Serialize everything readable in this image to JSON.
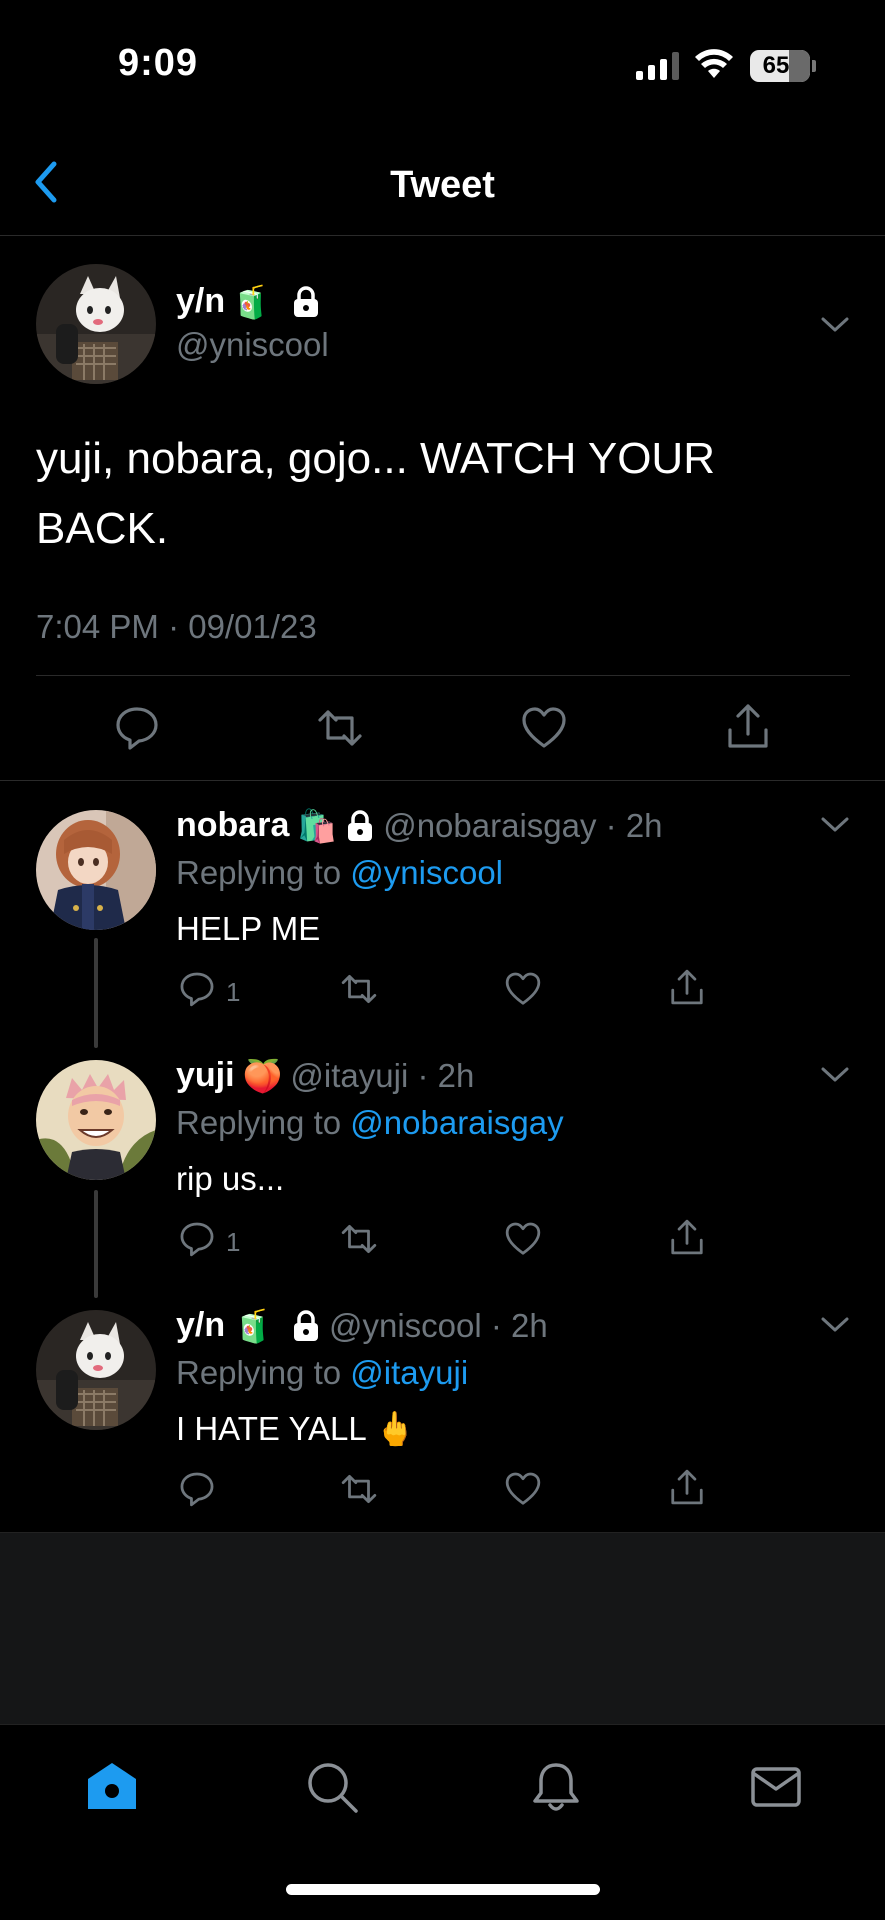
{
  "status_bar": {
    "time": "9:09",
    "battery": "65"
  },
  "header": {
    "title": "Tweet"
  },
  "main_tweet": {
    "name": "y/n",
    "name_emoji": "🧃",
    "handle": "@yniscool",
    "text": "yuji, nobara, gojo... WATCH YOUR BACK.",
    "timestamp": "7:04 PM · 09/01/23"
  },
  "replies": [
    {
      "name": "nobara",
      "name_emoji": "🛍️",
      "locked": true,
      "handle_time": "@nobaraisgay · 2h",
      "replying_prefix": "Replying to",
      "replying_to": "@yniscool",
      "text": "HELP ME",
      "reply_count": "1"
    },
    {
      "name": "yuji",
      "name_emoji": "🍑",
      "locked": false,
      "handle_time": "@itayuji · 2h",
      "replying_prefix": "Replying to",
      "replying_to": "@nobaraisgay",
      "text": "rip us...",
      "reply_count": "1"
    },
    {
      "name": "y/n",
      "name_emoji": "🧃",
      "locked": true,
      "handle_time": "@yniscool · 2h",
      "replying_prefix": "Replying to",
      "replying_to": "@itayuji",
      "text": "I HATE YALL 🖕",
      "reply_count": ""
    }
  ],
  "colors": {
    "accent": "#1d9bf0",
    "muted": "#6e767d",
    "background": "#000000"
  },
  "icons": {
    "tabs": [
      "home-icon",
      "search-icon",
      "bell-icon",
      "mail-icon"
    ],
    "actions": [
      "reply-icon",
      "retweet-icon",
      "like-icon",
      "share-icon"
    ]
  }
}
